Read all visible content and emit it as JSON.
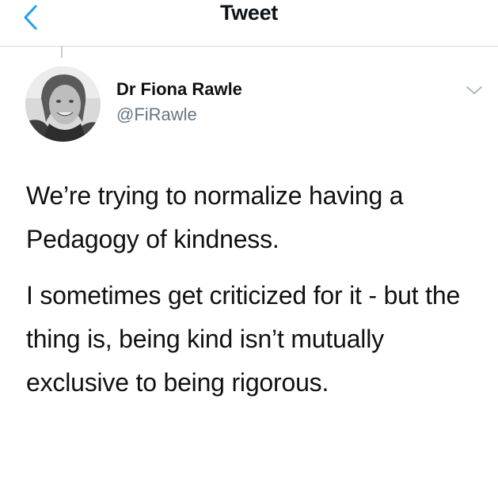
{
  "header": {
    "title": "Tweet",
    "back_icon": "chevron-left-icon",
    "accent_color": "#1da1f2"
  },
  "author": {
    "display_name": "Dr Fiona Rawle",
    "handle": "@FiRawle"
  },
  "tweet": {
    "paragraphs": [
      "We’re trying to normalize having a Pedagogy of kindness.",
      "I sometimes get criticized for it - but the thing is, being kind isn’t mutually exclusive to being rigorous."
    ]
  },
  "menu_icon": "chevron-down-icon"
}
